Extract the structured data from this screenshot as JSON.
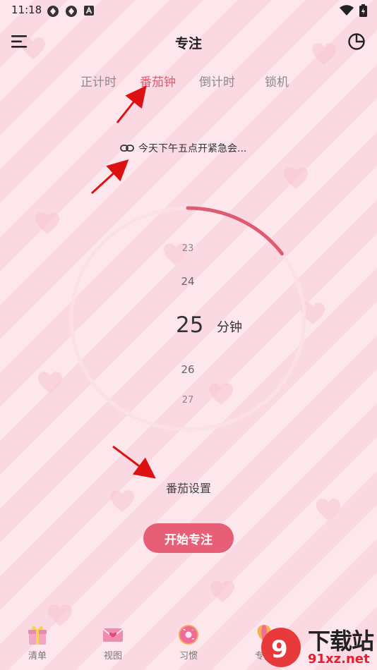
{
  "status_bar": {
    "time": "11:18"
  },
  "header": {
    "title": "专注"
  },
  "tabs": [
    {
      "label": "正计时",
      "active": false
    },
    {
      "label": "番茄钟",
      "active": true
    },
    {
      "label": "倒计时",
      "active": false
    },
    {
      "label": "锁机",
      "active": false
    }
  ],
  "task": {
    "label": "今天下午五点开紧急会..."
  },
  "timer": {
    "minutes_above": [
      "23",
      "24"
    ],
    "selected": "25",
    "unit": "分钟",
    "minutes_below": [
      "26",
      "27"
    ],
    "progress_fraction": 0.15
  },
  "settings_label": "番茄设置",
  "start_button": "开始专注",
  "bottom_nav": [
    {
      "label": "清单",
      "icon": "gift-icon"
    },
    {
      "label": "视图",
      "icon": "envelope-icon"
    },
    {
      "label": "习惯",
      "icon": "donut-icon"
    },
    {
      "label": "专注",
      "icon": "hot-air-balloon-icon"
    }
  ],
  "watermark": {
    "text": "下载站",
    "url": "91xz.net"
  },
  "colors": {
    "accent": "#e05a72",
    "button": "#e65f77",
    "ring": "#fbe0e6",
    "arrow": "#dd1111"
  }
}
